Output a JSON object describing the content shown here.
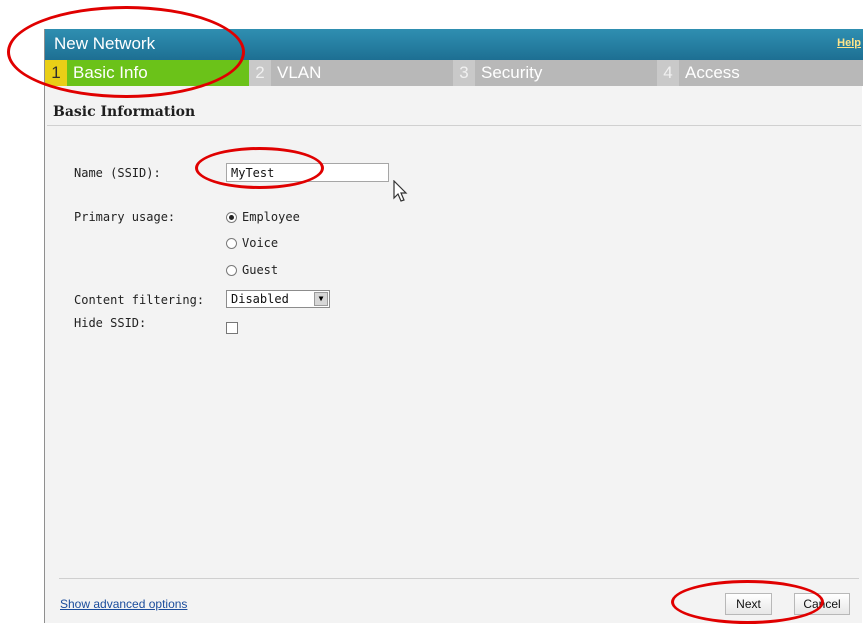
{
  "window": {
    "title": "New Network",
    "help_label": "Help"
  },
  "wizard_tabs": [
    {
      "number": "1",
      "label": "Basic Info",
      "active": true
    },
    {
      "number": "2",
      "label": "VLAN",
      "active": false
    },
    {
      "number": "3",
      "label": "Security",
      "active": false
    },
    {
      "number": "4",
      "label": "Access",
      "active": false
    }
  ],
  "section": {
    "title": "Basic Information"
  },
  "form": {
    "name": {
      "label": "Name (SSID):",
      "value": "MyTest"
    },
    "primary_usage": {
      "label": "Primary usage:",
      "options": [
        "Employee",
        "Voice",
        "Guest"
      ],
      "selected": "Employee"
    },
    "content_filtering": {
      "label": "Content filtering:",
      "value": "Disabled"
    },
    "hide_ssid": {
      "label": "Hide SSID:",
      "checked": false
    }
  },
  "footer": {
    "advanced_link": "Show advanced options",
    "next_label": "Next",
    "cancel_label": "Cancel"
  },
  "colors": {
    "titlebar": "#1d6f93",
    "active_tab": "#6bc219",
    "annotation": "#e00000"
  }
}
